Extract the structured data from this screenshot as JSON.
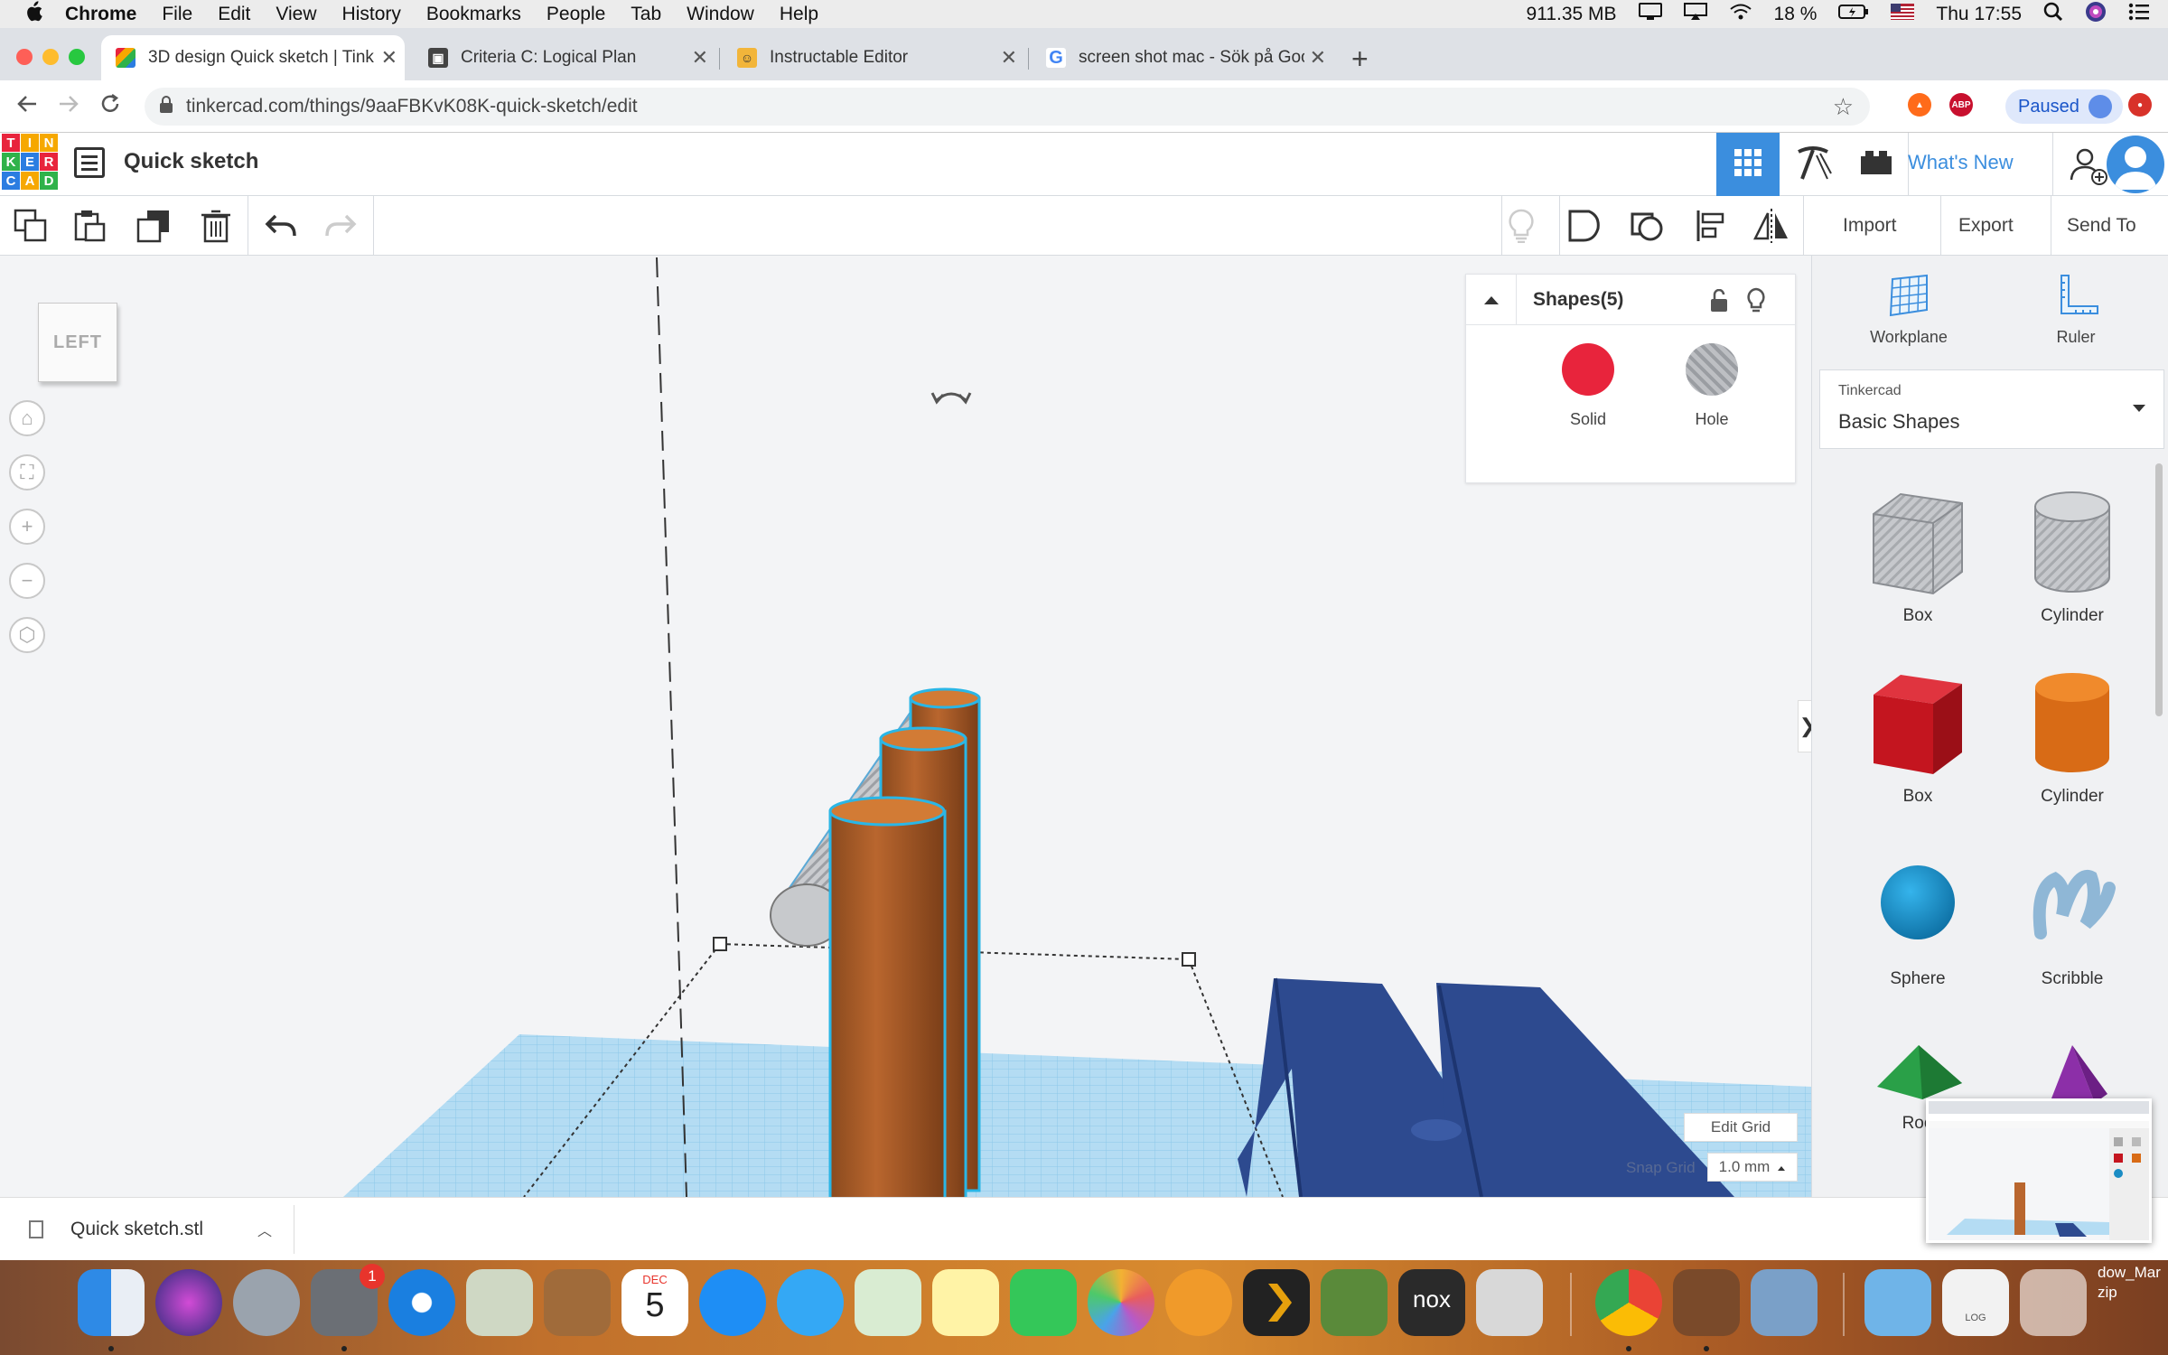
{
  "menubar": {
    "items": [
      "Chrome",
      "File",
      "Edit",
      "View",
      "History",
      "Bookmarks",
      "People",
      "Tab",
      "Window",
      "Help"
    ],
    "memory": "911.35 MB",
    "battery": "18 %",
    "clock": "Thu 17:55"
  },
  "tabs": [
    {
      "title": "3D design Quick sketch | Tinke",
      "active": true
    },
    {
      "title": "Criteria C: Logical Plan",
      "active": false
    },
    {
      "title": "Instructable Editor",
      "active": false
    },
    {
      "title": "screen shot mac - Sök på Goo",
      "active": false
    }
  ],
  "address": {
    "url": "tinkercad.com/things/9aaFBKvK08K-quick-sketch/edit",
    "profile_status": "Paused",
    "ext_abp": "ABP"
  },
  "tinkercad": {
    "logo_letters": [
      "T",
      "I",
      "N",
      "K",
      "E",
      "R",
      "C",
      "A",
      "D"
    ],
    "design_title": "Quick sketch",
    "whats_new": "What's New"
  },
  "toolbar": {
    "import": "Import",
    "export": "Export",
    "send_to": "Send To"
  },
  "workspace": {
    "viewcube_label": "LEFT",
    "edit_grid": "Edit Grid",
    "snap_grid_label": "Snap Grid",
    "snap_grid_value": "1.0 mm"
  },
  "shapes_panel": {
    "title": "Shapes(5)",
    "solid": "Solid",
    "hole": "Hole",
    "solid_color": "#e8243c"
  },
  "right_panel": {
    "workplane": "Workplane",
    "ruler": "Ruler",
    "library_source": "Tinkercad",
    "library_name": "Basic Shapes",
    "shapes": [
      "Box",
      "Cylinder",
      "Box",
      "Cylinder",
      "Sphere",
      "Scribble",
      "Roo"
    ]
  },
  "download": {
    "filename": "Quick sketch.stl"
  },
  "dock": {
    "calendar_month": "DEC",
    "calendar_day": "5",
    "badge": "1",
    "trailing_label_1": "dow_Mar",
    "trailing_label_2": "zip",
    "nox_label": "nox",
    "log_label": "LOG"
  }
}
